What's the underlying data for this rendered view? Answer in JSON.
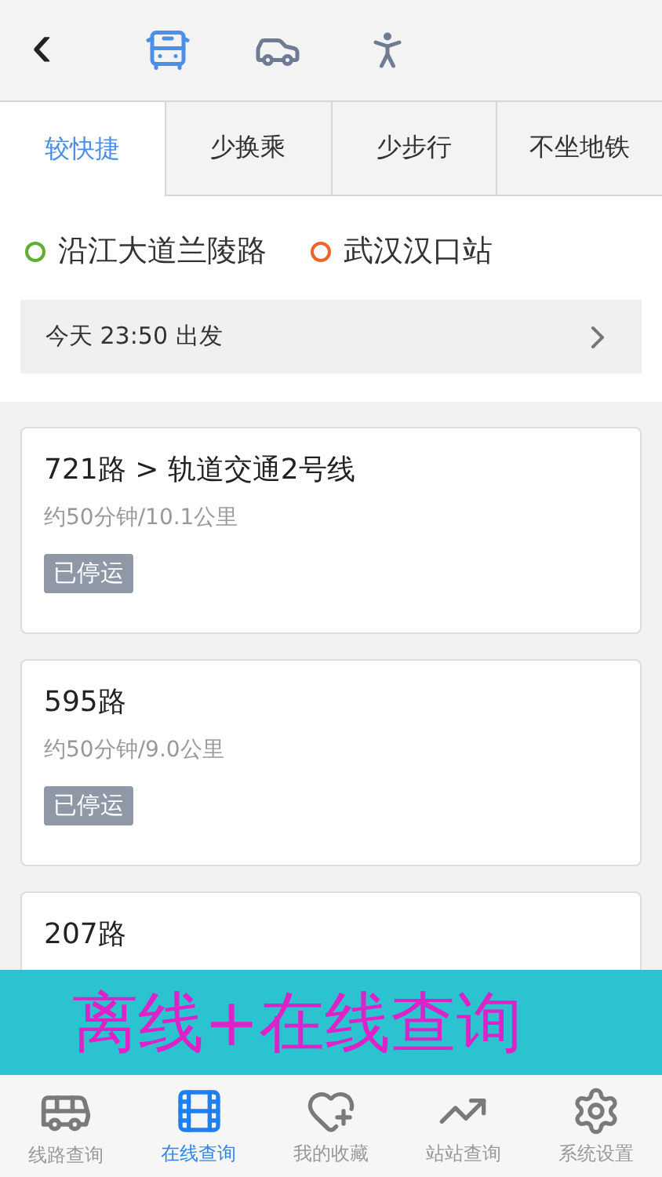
{
  "header": {
    "back": "‹",
    "modes": [
      {
        "kind": "bus",
        "selected": true
      },
      {
        "kind": "car",
        "selected": false
      },
      {
        "kind": "walk",
        "selected": false
      }
    ]
  },
  "tabs": [
    {
      "label": "较快捷",
      "selected": true
    },
    {
      "label": "少换乘",
      "selected": false
    },
    {
      "label": "少步行",
      "selected": false
    },
    {
      "label": "不坐地铁",
      "selected": false
    }
  ],
  "endpoints": [
    {
      "name": "沿江大道兰陵路",
      "color": "#5fae2e"
    },
    {
      "name": "武汉汉口站",
      "color": "#f0642a"
    }
  ],
  "departure": {
    "label": "今天 23:50 出发"
  },
  "routes": [
    {
      "title": "721路 > 轨道交通2号线",
      "detail": "约50分钟/10.1公里",
      "status": "已停运"
    },
    {
      "title": "595路",
      "detail": "约50分钟/9.0公里",
      "status": "已停运"
    },
    {
      "title": "207路"
    }
  ],
  "banner": "离线+在线查询",
  "tab_bar": [
    {
      "label": "线路查询",
      "kind": "bus",
      "selected": false
    },
    {
      "label": "在线查询",
      "kind": "film",
      "selected": true
    },
    {
      "label": "我的收藏",
      "kind": "heart",
      "selected": false
    },
    {
      "label": "站站查询",
      "kind": "trend",
      "selected": false
    },
    {
      "label": "系统设置",
      "kind": "gear",
      "selected": false
    }
  ]
}
